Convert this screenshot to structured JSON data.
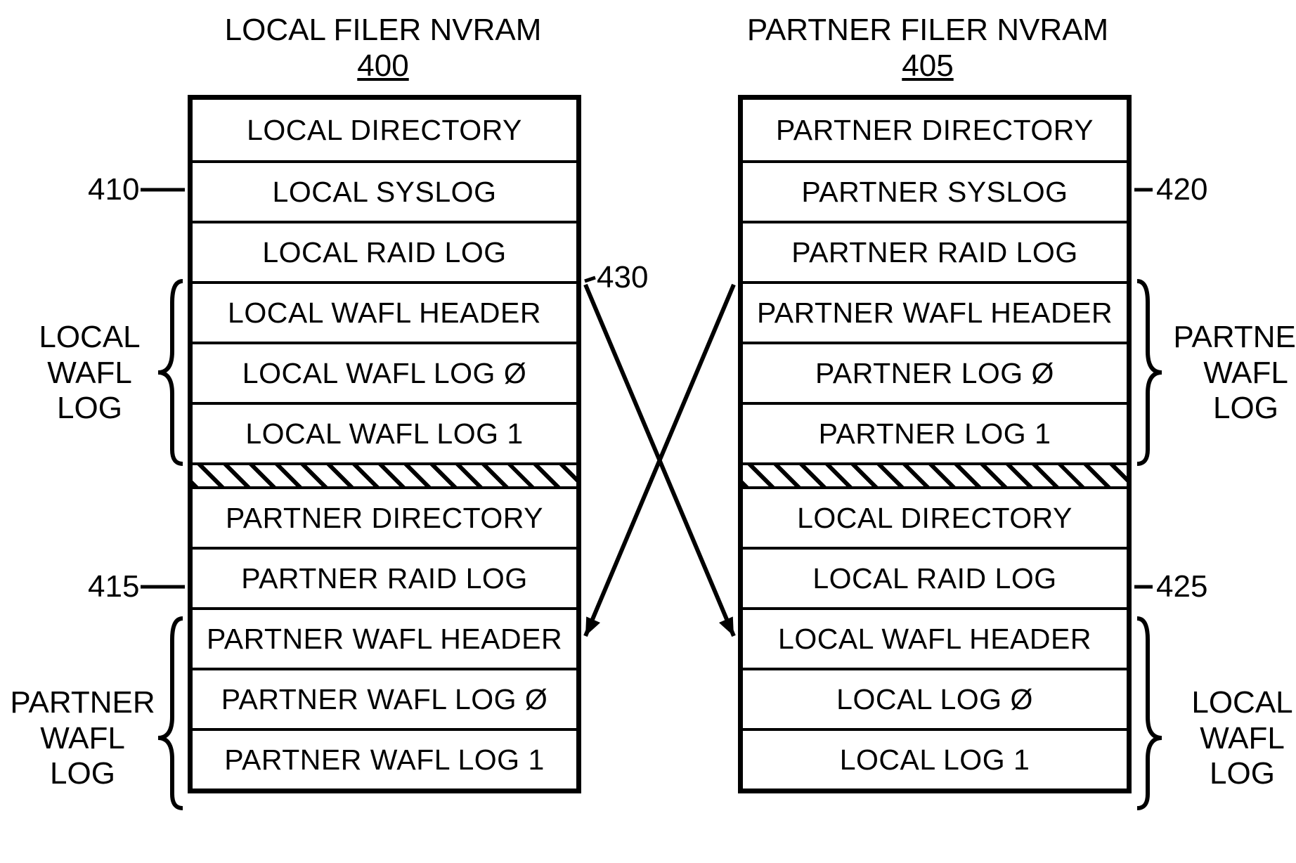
{
  "left": {
    "title": "LOCAL FILER NVRAM",
    "num": "400",
    "rows_top": [
      "LOCAL DIRECTORY",
      "LOCAL SYSLOG",
      "LOCAL RAID LOG",
      "LOCAL WAFL HEADER",
      "LOCAL WAFL LOG Ø",
      "LOCAL WAFL LOG 1"
    ],
    "rows_bottom": [
      "PARTNER DIRECTORY",
      "PARTNER RAID LOG",
      "PARTNER WAFL HEADER",
      "PARTNER WAFL LOG Ø",
      "PARTNER WAFL LOG 1"
    ],
    "brace_top_label": "LOCAL\nWAFL\nLOG",
    "brace_bottom_label": "PARTNER\nWAFL\nLOG",
    "ref_top": "410",
    "ref_bottom": "415",
    "ref_mid": "430"
  },
  "right": {
    "title": "PARTNER FILER NVRAM",
    "num": "405",
    "rows_top": [
      "PARTNER DIRECTORY",
      "PARTNER SYSLOG",
      "PARTNER RAID LOG",
      "PARTNER WAFL HEADER",
      "PARTNER LOG Ø",
      "PARTNER LOG 1"
    ],
    "rows_bottom": [
      "LOCAL DIRECTORY",
      "LOCAL RAID LOG",
      "LOCAL WAFL HEADER",
      "LOCAL LOG Ø",
      "LOCAL LOG 1"
    ],
    "brace_top_label": "PARTNER\nWAFL\nLOG",
    "brace_bottom_label": "LOCAL\nWAFL\nLOG",
    "ref_top": "420",
    "ref_bottom": "425"
  }
}
